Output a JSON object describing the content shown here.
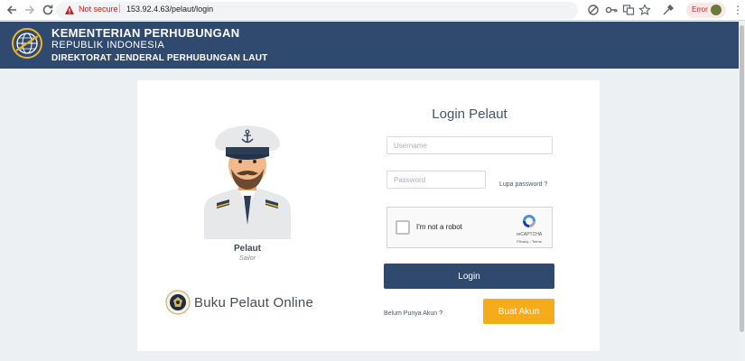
{
  "browser": {
    "security_label": "Not secure",
    "separator": "|",
    "url": "153.92.4.63/pelaut/login",
    "error_label": "Error"
  },
  "header": {
    "line1": "KEMENTERIAN PERHUBUNGAN",
    "line2": "REPUBLIK INDONESIA",
    "line3": "DIREKTORAT JENDERAL PERHUBUNGAN LAUT"
  },
  "profile": {
    "name": "Pelaut",
    "subtitle": "Sailor"
  },
  "brand": {
    "title": "Buku Pelaut Online"
  },
  "login": {
    "title": "Login Pelaut",
    "username_placeholder": "Username",
    "password_placeholder": "Password",
    "forgot_label": "Lupa password ?",
    "captcha_label": "I'm not a robot",
    "captcha_brand": "reCAPTCHA",
    "captcha_links": "Privacy - Terms",
    "login_button": "Login",
    "no_account_label": "Belum Punya Akun ?",
    "register_button": "Buat Akun"
  },
  "colors": {
    "header_bg": "#2f4a6e",
    "page_bg": "#edf0f3",
    "login_button": "#2f4a6e",
    "register_button": "#f5ab1b",
    "not_secure": "#c5221f"
  },
  "icons": {
    "back": "arrow-left-icon",
    "forward": "arrow-right-icon",
    "reload": "reload-icon",
    "security": "warning-triangle-icon",
    "logo": "ministry-logo-icon",
    "sailor": "sailor-avatar-icon",
    "captcha": "recaptcha-logo-icon"
  }
}
